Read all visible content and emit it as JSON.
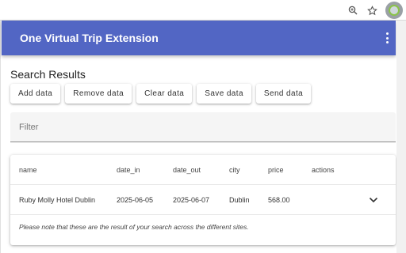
{
  "browser": {
    "icons": [
      "zoom-icon",
      "bookmark-star-icon",
      "extension-icon"
    ]
  },
  "app_bar": {
    "title": "One Virtual Trip Extension",
    "menu_icon": "more-vert-icon",
    "color": "#5266c4"
  },
  "main": {
    "section_title": "Search Results",
    "buttons": {
      "add": "Add data",
      "remove": "Remove data",
      "clear": "Clear data",
      "save": "Save data",
      "send": "Send data"
    },
    "filter": {
      "placeholder": "Filter",
      "value": ""
    },
    "table": {
      "columns": {
        "name": "name",
        "date_in": "date_in",
        "date_out": "date_out",
        "city": "city",
        "price": "price",
        "actions": "actions"
      },
      "rows": [
        {
          "name": "Ruby Molly Hotel Dublin",
          "date_in": "2025-06-05",
          "date_out": "2025-06-07",
          "city": "Dublin",
          "price": "568.00"
        }
      ],
      "note": "Please note that these are the result of your search across the different sites."
    }
  }
}
